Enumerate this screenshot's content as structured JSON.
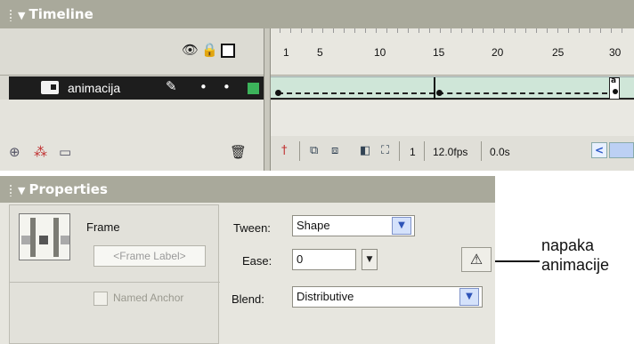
{
  "timeline": {
    "title": "Timeline",
    "header_icons": [
      "eye-icon",
      "lock-icon",
      "outline-icon"
    ],
    "layer": {
      "name": "animacija",
      "icon": "layer-icon",
      "edit_icon": "pencil-icon",
      "dots": [
        "•",
        "•"
      ],
      "outline_color": "#3cb35b"
    },
    "ruler_labels": [
      "1",
      "5",
      "10",
      "15",
      "20",
      "25",
      "30"
    ],
    "keyframes": {
      "start": 1,
      "middle": 15,
      "end": 30,
      "end_label": "a"
    },
    "bottom_icons": [
      "insert-layer-icon",
      "add-motion-guide-icon",
      "insert-folder-icon",
      "trash-icon"
    ],
    "controls": {
      "current_frame": "1",
      "frame_rate": "12.0fps",
      "elapsed": "0.0s"
    }
  },
  "properties": {
    "title": "Properties",
    "frame_caption": "Frame",
    "frame_label_placeholder": "<Frame Label>",
    "named_anchor": "Named Anchor",
    "tween_label": "Tween:",
    "tween_value": "Shape",
    "ease_label": "Ease:",
    "ease_value": "0",
    "blend_label": "Blend:",
    "blend_value": "Distributive",
    "warning_icon": "warning-icon"
  },
  "callout": {
    "line1": "napaka",
    "line2": "animacije"
  },
  "colors": {
    "panel_title_bg": "#a9a99b",
    "layer_row_bg": "#1d1d1d",
    "frames_bg": "#cfe6d8",
    "playhead": "#e03a3a"
  }
}
